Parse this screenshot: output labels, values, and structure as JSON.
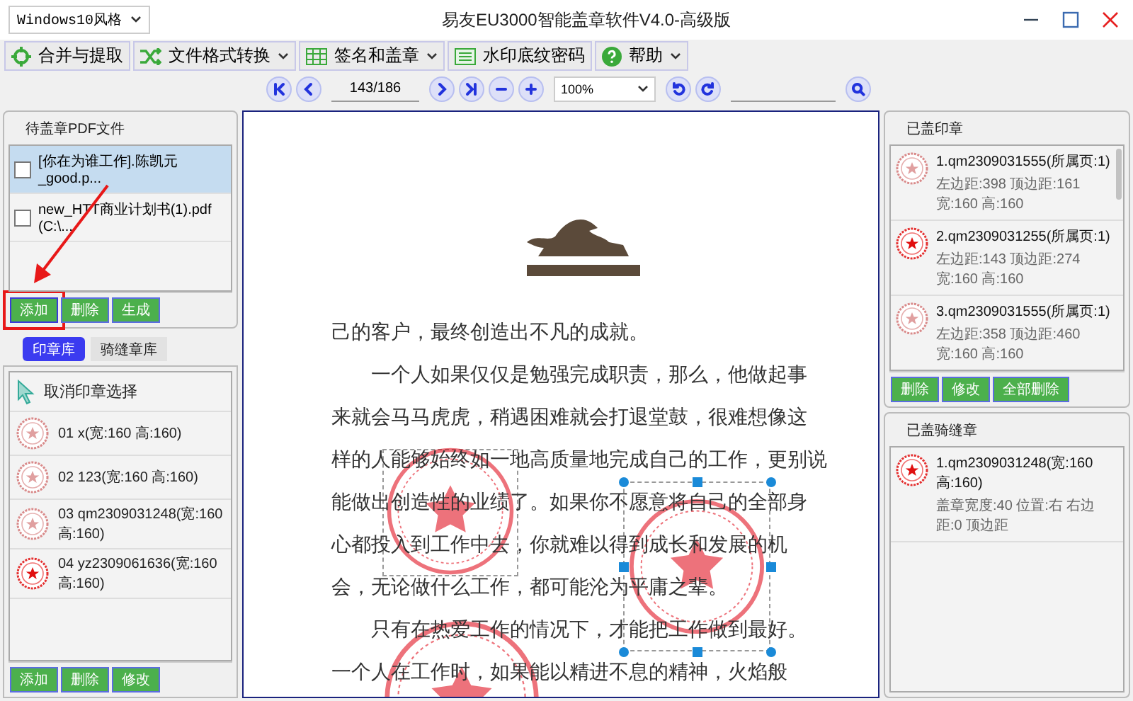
{
  "window": {
    "title": "易友EU3000智能盖章软件V4.0-高级版",
    "style_select": "Windows10风格"
  },
  "toolbar": [
    {
      "label": "合并与提取",
      "kind": "merge",
      "has_menu": false
    },
    {
      "label": "文件格式转换",
      "kind": "convert",
      "has_menu": true
    },
    {
      "label": "签名和盖章",
      "kind": "grid",
      "has_menu": true
    },
    {
      "label": "水印底纹密码",
      "kind": "list",
      "has_menu": false
    },
    {
      "label": "帮助",
      "kind": "help",
      "has_menu": true
    }
  ],
  "navigator": {
    "page": "143/186",
    "zoom": "100%"
  },
  "pending_files": {
    "title": "待盖章PDF文件",
    "files": [
      {
        "name": "[你在为谁工作].陈凯元_good.p...",
        "checked": false,
        "selected": true
      },
      {
        "name": "new_HTT商业计划书(1).pdf (C:\\...",
        "checked": false,
        "selected": false
      }
    ],
    "buttons": [
      {
        "label": "添加",
        "highlighted": true
      },
      {
        "label": "删除",
        "highlighted": false
      },
      {
        "label": "生成",
        "highlighted": false
      }
    ]
  },
  "library_tabs": [
    {
      "label": "印章库",
      "selected": true
    },
    {
      "label": "骑缝章库",
      "selected": false
    }
  ],
  "seal_library": {
    "deselect_label": "取消印章选择",
    "items": [
      {
        "label": "01 x(宽:160 高:160)"
      },
      {
        "label": "02 123(宽:160 高:160)"
      },
      {
        "label": "03 qm2309031248(宽:160 高:160)"
      },
      {
        "label": "04 yz2309061636(宽:160 高:160)"
      }
    ],
    "buttons": [
      {
        "label": "添加"
      },
      {
        "label": "删除"
      },
      {
        "label": "修改"
      }
    ]
  },
  "document": {
    "lines": [
      {
        "text": "己的客户，最终创造出不凡的成就。",
        "indent": false
      },
      {
        "text": "一个人如果仅仅是勉强完成职责，那么，他做起事",
        "indent": true
      },
      {
        "text": "来就会马马虎虎，稍遇困难就会打退堂鼓，很难想像这",
        "indent": false
      },
      {
        "text": "样的人能够始终如一地高质量地完成自己的工作，更别说",
        "indent": false
      },
      {
        "text": "能做出创造性的业绩了。如果你不愿意将自己的全部身",
        "indent": false
      },
      {
        "text": "心都投入到工作中去，你就难以得到成长和发展的机",
        "indent": false
      },
      {
        "text": "会，无论做什么工作，都可能沦为平庸之辈。",
        "indent": false
      },
      {
        "text": "只有在热爱工作的情况下，才能把工作做到最好。",
        "indent": true
      },
      {
        "text": "一个人在工作时，如果能以精进不息的精神，火焰般",
        "indent": false
      }
    ]
  },
  "placed_seals": {
    "title": "已盖印章",
    "items": [
      {
        "name": "1.qm2309031555(所属页:1)",
        "detail": "左边距:398 顶边距:161 宽:160 高:160"
      },
      {
        "name": "2.qm2309031255(所属页:1)",
        "detail": "左边距:143 顶边距:274 宽:160 高:160"
      },
      {
        "name": "3.qm2309031555(所属页:1)",
        "detail": "左边距:358 顶边距:460 宽:160 高:160"
      }
    ],
    "buttons": [
      {
        "label": "删除"
      },
      {
        "label": "修改"
      },
      {
        "label": "全部删除"
      }
    ]
  },
  "riding_seals": {
    "title": "已盖骑缝章",
    "items": [
      {
        "name": "1.qm2309031248(宽:160 高:160)",
        "detail": "盖章宽度:40 位置:右 右边距:0 顶边距"
      }
    ]
  }
}
